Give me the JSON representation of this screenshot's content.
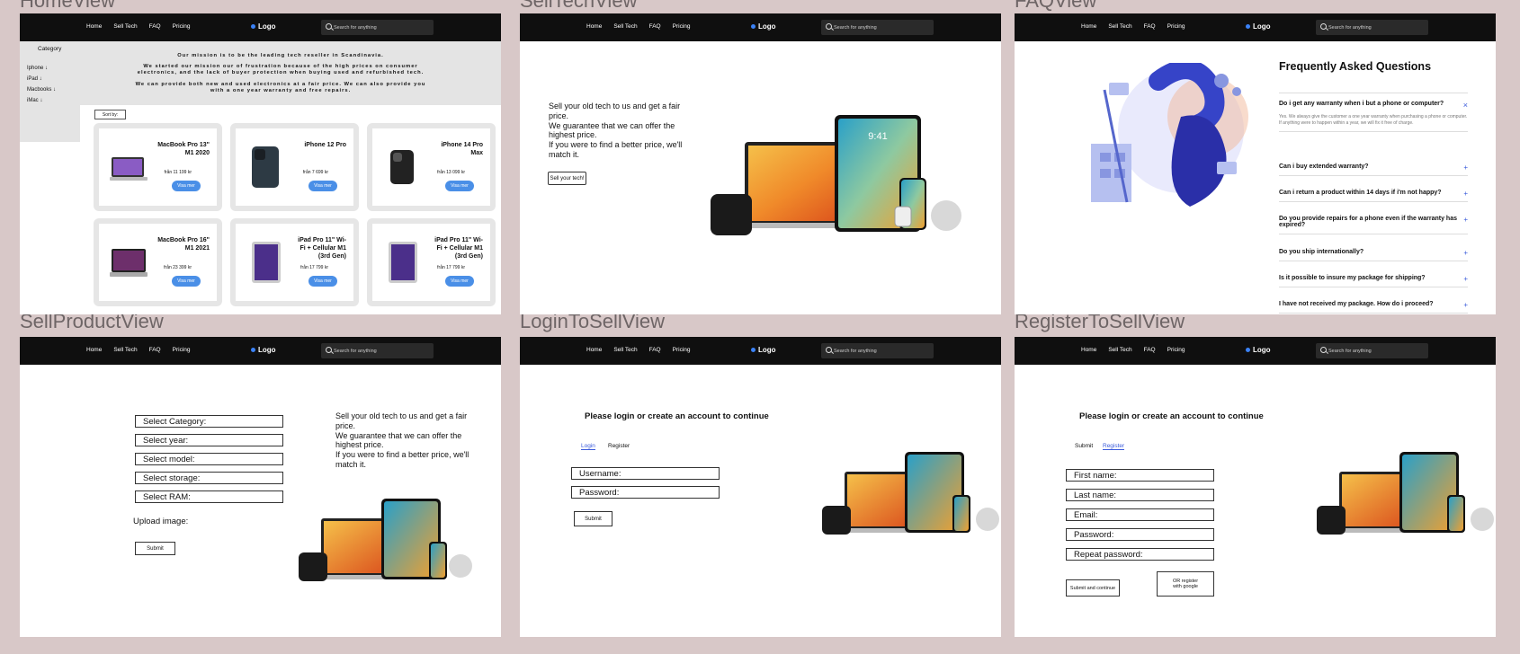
{
  "frame_labels": [
    "HomeView",
    "SellTechView",
    "FAQView",
    "SellProductView",
    "LoginToSellView",
    "RegisterToSellView"
  ],
  "nav": {
    "links": [
      "Home",
      "Sell Tech",
      "FAQ",
      "Pricing"
    ],
    "logo": "Logo",
    "search_placeholder": "Search for anything"
  },
  "home": {
    "category_title": "Category",
    "categories": [
      "Iphone ↓",
      "iPad ↓",
      "Macbooks ↓",
      "iMac ↓"
    ],
    "mission": [
      "Our mission is to be the leading tech reseller in Scandinavia.",
      "We started our mission our of frustration because of the high prices on consumer electronics, and the lack of buyer protection when buying used and refurbished tech.",
      "We can provide both new and used electronics at a fair price. We can also provide you with a one year warranty and free repairs."
    ],
    "sort_label": "Sort by:",
    "products": [
      {
        "name": "MacBook Pro 13\" M1 2020",
        "price": "från 11 199 kr",
        "button": "Visa mer"
      },
      {
        "name": "iPhone 12 Pro",
        "price": "från 7 699 kr",
        "button": "Visa mer"
      },
      {
        "name": "iPhone 14 Pro Max",
        "price": "från 13 099 kr",
        "button": "Visa mer"
      },
      {
        "name": "MacBook Pro 16\" M1 2021",
        "price": "från 23 399 kr",
        "button": "Visa mer"
      },
      {
        "name": "iPad Pro 11\" Wi-Fi + Cellular M1 (3rd Gen)",
        "price": "från 17 799 kr",
        "button": "Visa mer"
      },
      {
        "name": "iPad Pro 11\" Wi-Fi + Cellular M1 (3rd Gen)",
        "price": "från 17 799 kr",
        "button": "Visa mer"
      }
    ]
  },
  "sell_tech": {
    "text": "Sell your old tech to us and get a fair price.\nWe guarantee that we can offer the highest price.\nIf you were to find a better price, we'll match it.",
    "button": "Sell your tech!",
    "device_time": "9:41"
  },
  "faq": {
    "title": "Frequently Asked Questions",
    "open_question": "Do i get any warranty when i but a phone or computer?",
    "open_answer": "Yes. We always give the customer a one year warranty when purchasing a phone or computer. If anything were to happen within a year, we will fix it free of charge.",
    "questions": [
      "Can i buy extended warranty?",
      "Can i return a product within 14 days if i'm not happy?",
      "Do you provide repairs for a phone even if the warranty has expired?",
      "Do you ship internationally?",
      "Is it possible to insure my package for shipping?",
      "I have not received my package. How do i proceed?"
    ]
  },
  "sell_product": {
    "selects": [
      "Select Category:",
      "Select year:",
      "Select model:",
      "Select storage:",
      "Select RAM:"
    ],
    "upload": "Upload image:",
    "submit": "Submit",
    "text": "Sell your old tech to us and get a fair price.\nWe guarantee that we can offer the highest price.\nIf you were to find a better price, we'll match it."
  },
  "login": {
    "heading": "Please login or create an account to continue",
    "tabs": [
      "Login",
      "Register"
    ],
    "fields": [
      "Username:",
      "Password:"
    ],
    "submit": "Submit"
  },
  "register": {
    "heading": "Please login or create an account to continue",
    "tabs": [
      "Submit",
      "Register"
    ],
    "fields": [
      "First name:",
      "Last name:",
      "Email:",
      "Password:",
      "Repeat password:"
    ],
    "submit": "Submit and continue",
    "google": "OR register with google"
  },
  "colors": {
    "accent": "#4a8fe7",
    "nav": "#0f0f0f",
    "background": "#d8c8c8"
  }
}
